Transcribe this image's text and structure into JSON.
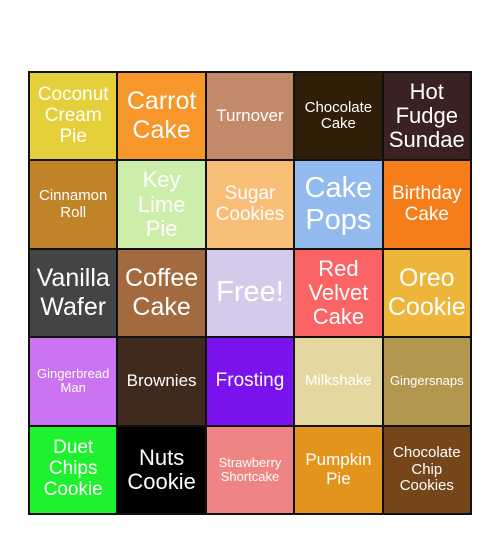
{
  "board": {
    "cells": [
      {
        "label": "Coconut Cream Pie",
        "color": "#E5CF3A"
      },
      {
        "label": "Carrot Cake",
        "color": "#F7962A"
      },
      {
        "label": "Turnover",
        "color": "#C28A69"
      },
      {
        "label": "Chocolate Cake",
        "color": "#2F1F08"
      },
      {
        "label": "Hot Fudge Sundae",
        "color": "#3A2222"
      },
      {
        "label": "Cinnamon Roll",
        "color": "#C08327"
      },
      {
        "label": "Key Lime Pie",
        "color": "#CDEEAA"
      },
      {
        "label": "Sugar Cookies",
        "color": "#F8BE78"
      },
      {
        "label": "Cake Pops",
        "color": "#92BAEE"
      },
      {
        "label": "Birthday Cake",
        "color": "#F57E1A"
      },
      {
        "label": "Vanilla Wafer",
        "color": "#444444"
      },
      {
        "label": "Coffee Cake",
        "color": "#A36A40"
      },
      {
        "label": "Free!",
        "color": "#D4CAEA"
      },
      {
        "label": "Red Velvet Cake",
        "color": "#FB6464"
      },
      {
        "label": "Oreo Cookie",
        "color": "#EDB63A"
      },
      {
        "label": "Gingerbread Man",
        "color": "#CA74F2"
      },
      {
        "label": "Brownies",
        "color": "#3F2A1D"
      },
      {
        "label": "Frosting",
        "color": "#7A12EE"
      },
      {
        "label": "Milkshake",
        "color": "#E4D8A0"
      },
      {
        "label": "Gingersnaps",
        "color": "#B3974F"
      },
      {
        "label": "Duet Chips Cookie",
        "color": "#1EF22E"
      },
      {
        "label": "Nuts Cookie",
        "color": "#000000"
      },
      {
        "label": "Strawberry Shortcake",
        "color": "#EE8484"
      },
      {
        "label": "Pumpkin Pie",
        "color": "#E2941C"
      },
      {
        "label": "Chocolate Chip Cookies",
        "color": "#74461A"
      }
    ]
  }
}
